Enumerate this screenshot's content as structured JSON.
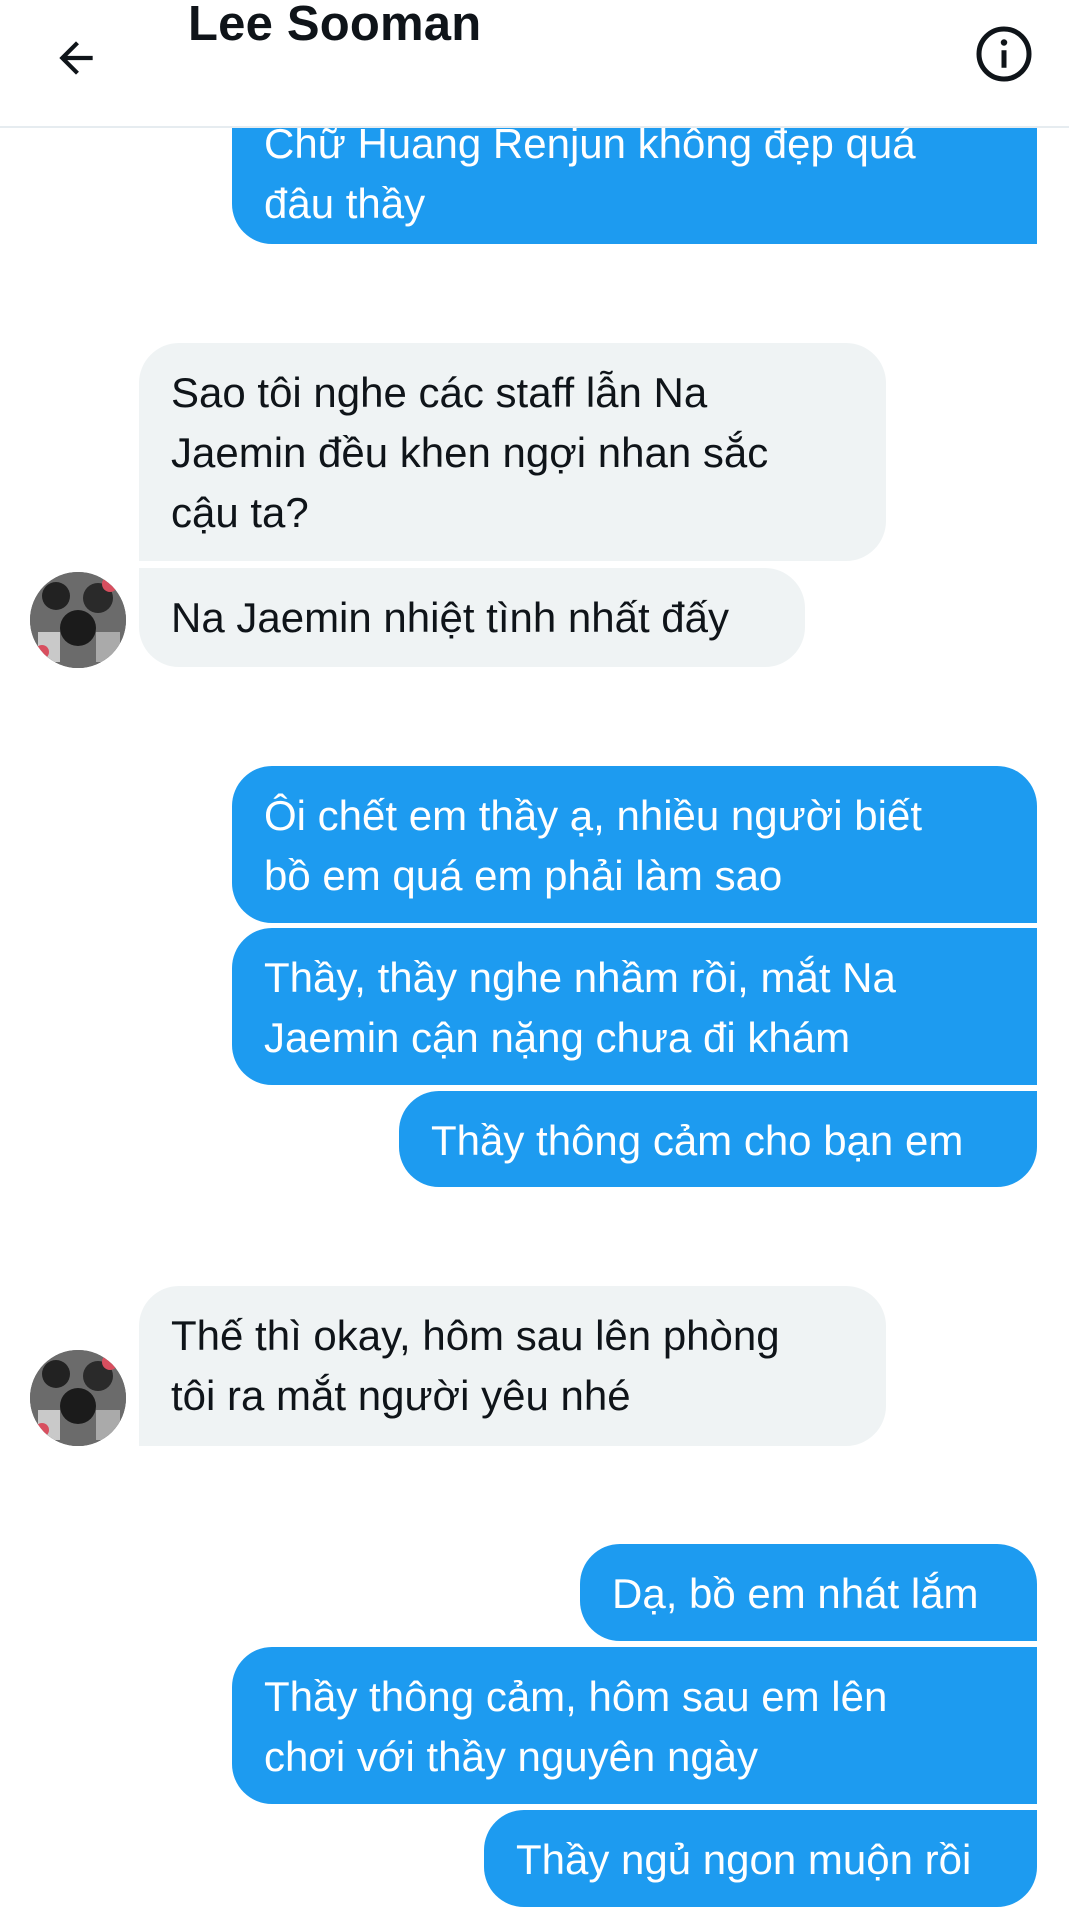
{
  "header": {
    "title": "Lee Sooman"
  },
  "messages": [
    {
      "text": "Chữ Huang Renjun không đẹp quá\nđâu thầy"
    },
    {
      "text": "Sao tôi nghe các staff lẫn Na\nJaemin đều khen ngợi nhan sắc\ncậu ta?"
    },
    {
      "text": "Na Jaemin nhiệt tình nhất đấy"
    },
    {
      "text": "Ôi chết em thầy ạ, nhiều người biết\nbồ em quá em phải làm sao"
    },
    {
      "text": "Thầy, thầy nghe nhầm rồi, mắt Na\nJaemin cận nặng chưa đi khám"
    },
    {
      "text": "Thầy thông cảm cho bạn em"
    },
    {
      "text": "Thế thì okay, hôm sau lên phòng\ntôi ra mắt người yêu nhé"
    },
    {
      "text": "Dạ, bồ em nhát lắm"
    },
    {
      "text": "Thầy thông cảm, hôm sau em lên\nchơi với thầy nguyên ngày"
    },
    {
      "text": "Thầy ngủ ngon muộn rồi"
    }
  ],
  "colors": {
    "sent_bubble": "#1d9bf0",
    "received_bubble": "#eff3f4",
    "divider": "#e6ecf0"
  },
  "icons": {
    "back": "arrow-left-icon",
    "info": "info-icon",
    "avatar": "contact-avatar"
  }
}
